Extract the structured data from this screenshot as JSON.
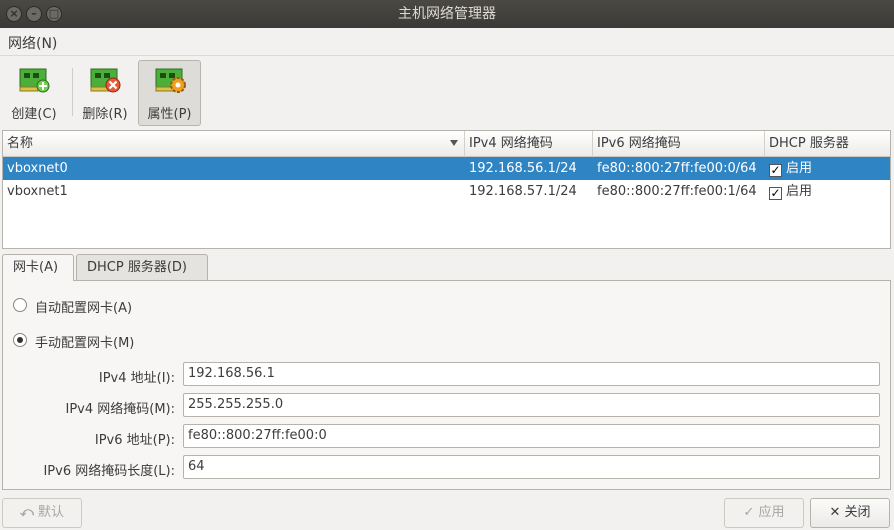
{
  "window": {
    "title": "主机网络管理器"
  },
  "menu": {
    "network_label": "网络(N)"
  },
  "toolbar": {
    "create_label": "创建(C)",
    "delete_label": "删除(R)",
    "properties_label": "属性(P)"
  },
  "table": {
    "headers": [
      "名称",
      "IPv4 网络掩码",
      "IPv6 网络掩码",
      "DHCP 服务器"
    ],
    "rows": [
      {
        "name": "vboxnet0",
        "ipv4": "192.168.56.1/24",
        "ipv6": "fe80::800:27ff:fe00:0/64",
        "dhcp": "启用",
        "dhcp_checked": true,
        "selected": true
      },
      {
        "name": "vboxnet1",
        "ipv4": "192.168.57.1/24",
        "ipv6": "fe80::800:27ff:fe00:1/64",
        "dhcp": "启用",
        "dhcp_checked": true,
        "selected": false
      }
    ]
  },
  "tabs": {
    "adapter": "网卡(A)",
    "dhcp": "DHCP 服务器(D)"
  },
  "adapter": {
    "auto_label": "自动配置网卡(A)",
    "manual_label": "手动配置网卡(M)",
    "selected_mode": "manual",
    "ipv4_addr_label": "IPv4 地址(I):",
    "ipv4_addr_value": "192.168.56.1",
    "ipv4_mask_label": "IPv4 网络掩码(M):",
    "ipv4_mask_value": "255.255.255.0",
    "ipv6_addr_label": "IPv6 地址(P):",
    "ipv6_addr_value": "fe80::800:27ff:fe00:0",
    "ipv6_prefix_label": "IPv6 网络掩码长度(L):",
    "ipv6_prefix_value": "64"
  },
  "buttons": {
    "default_label": "默认",
    "apply_label": "应用",
    "close_label": "关闭"
  },
  "colors": {
    "selection": "#2f84c4",
    "titlebar": "#3c3b37"
  },
  "icons": {
    "create": "network-card-plus-icon",
    "delete": "network-card-x-icon",
    "properties": "network-card-gear-icon"
  }
}
